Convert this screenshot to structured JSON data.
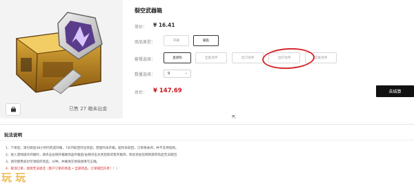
{
  "product": {
    "title": "裂空武器箱",
    "unit_price_label": "单价：",
    "unit_price": "¥ 16.41",
    "sold_text": "已售 27 箱未出金"
  },
  "goods_type": {
    "label": "商品类型：",
    "options": [
      "开箱",
      "箱匙"
    ],
    "selected_index": 1
  },
  "package": {
    "label": "套餐选择：",
    "options": [
      "直接购",
      "全金池评",
      "出刀池评",
      "出打池评",
      "出金池评"
    ],
    "selected_index": 0
  },
  "quantity": {
    "label": "数量选择：",
    "value": "9"
  },
  "total": {
    "label": "总价：",
    "value": "¥ 147.69"
  },
  "buy_label": "去结算",
  "rules": {
    "title": "玩法说明",
    "lines": [
      "1、下单后，请付款后48小时内完成开箱，7天内取回开出饰品；若超时未开箱，超时未取回，订单将关闭，并不支持退款。",
      "2、进入游戏操作开箱时，请点击右侧开箱箱饰品开箱后/右侧点击兑奖后取货客开箱饰，和您领会在网购获得饰品无法取回",
      "3、请勿使用多封可领取的饰品，分钟，并确保交易链接填写正确。",
      "4、取消订单，退款无法退还（客户订单的饰品 • 全部饰品，订单取回方有！！）"
    ]
  },
  "colors": {
    "accent_red": "#c8161d",
    "buy_button": "#111111",
    "annotation_circle": "#d4262b",
    "watermark": "#e8a31c"
  },
  "watermark_text": "玩 玩"
}
